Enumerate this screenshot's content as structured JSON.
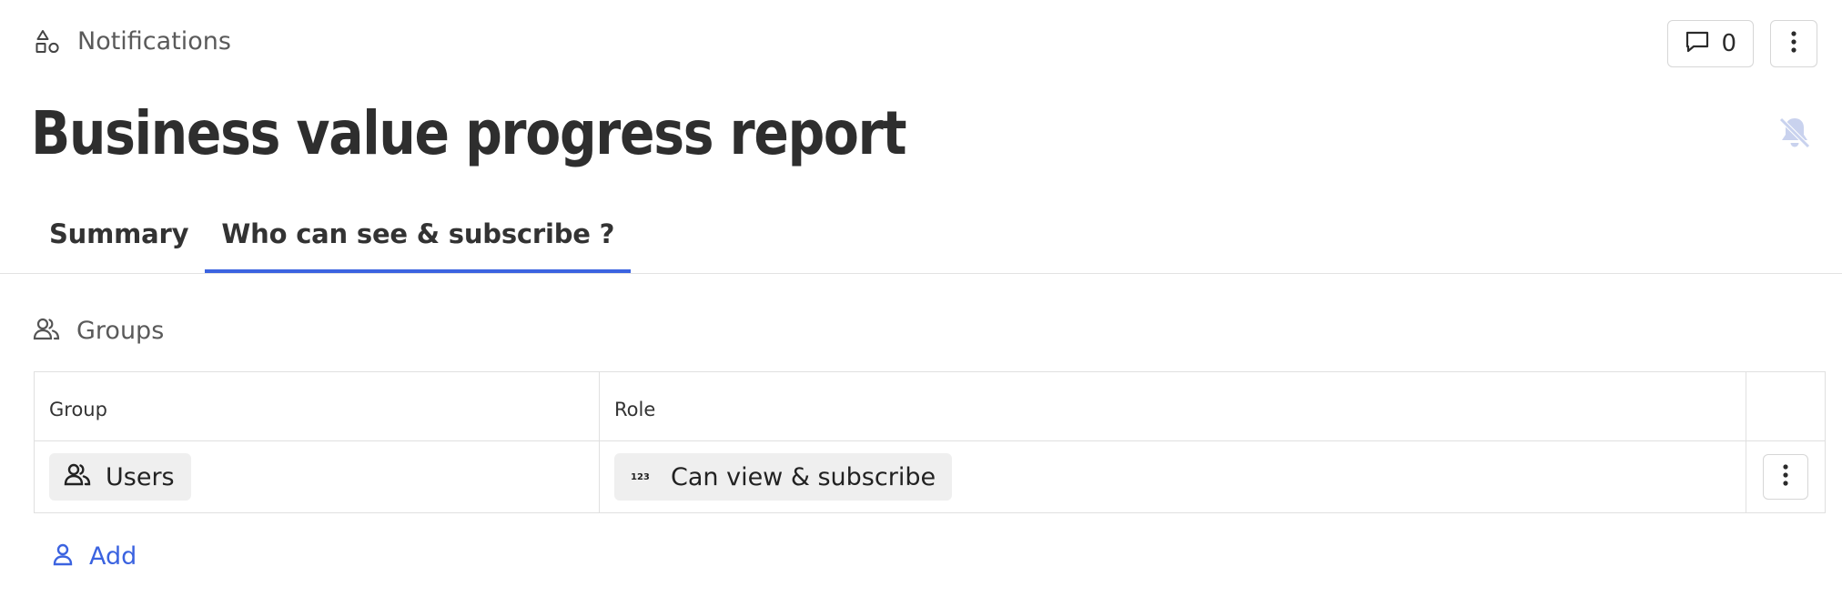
{
  "header": {
    "section_label": "Notifications",
    "comments_count": "0",
    "title": "Business value progress report"
  },
  "tabs": [
    {
      "label": "Summary",
      "active": false
    },
    {
      "label": "Who can see & subscribe ?",
      "active": true
    }
  ],
  "groups_section": {
    "label": "Groups",
    "table": {
      "columns": [
        "Group",
        "Role",
        ""
      ],
      "rows": [
        {
          "group": "Users",
          "role": "Can view & subscribe"
        }
      ]
    },
    "add_label": "Add"
  },
  "colors": {
    "accent": "#3b63e0",
    "text": "#2b2b2b",
    "muted": "#5a5a5a",
    "chip_bg": "#efefef",
    "border": "#e0e0e0",
    "disabled_icon": "#c9d2ee"
  },
  "icons": {
    "section": "shapes-icon",
    "comments": "comment-icon",
    "menu": "kebab-menu-icon",
    "notifications": "bell-off-icon",
    "groups": "users-icon",
    "role": "number-123-icon",
    "add": "person-icon"
  }
}
